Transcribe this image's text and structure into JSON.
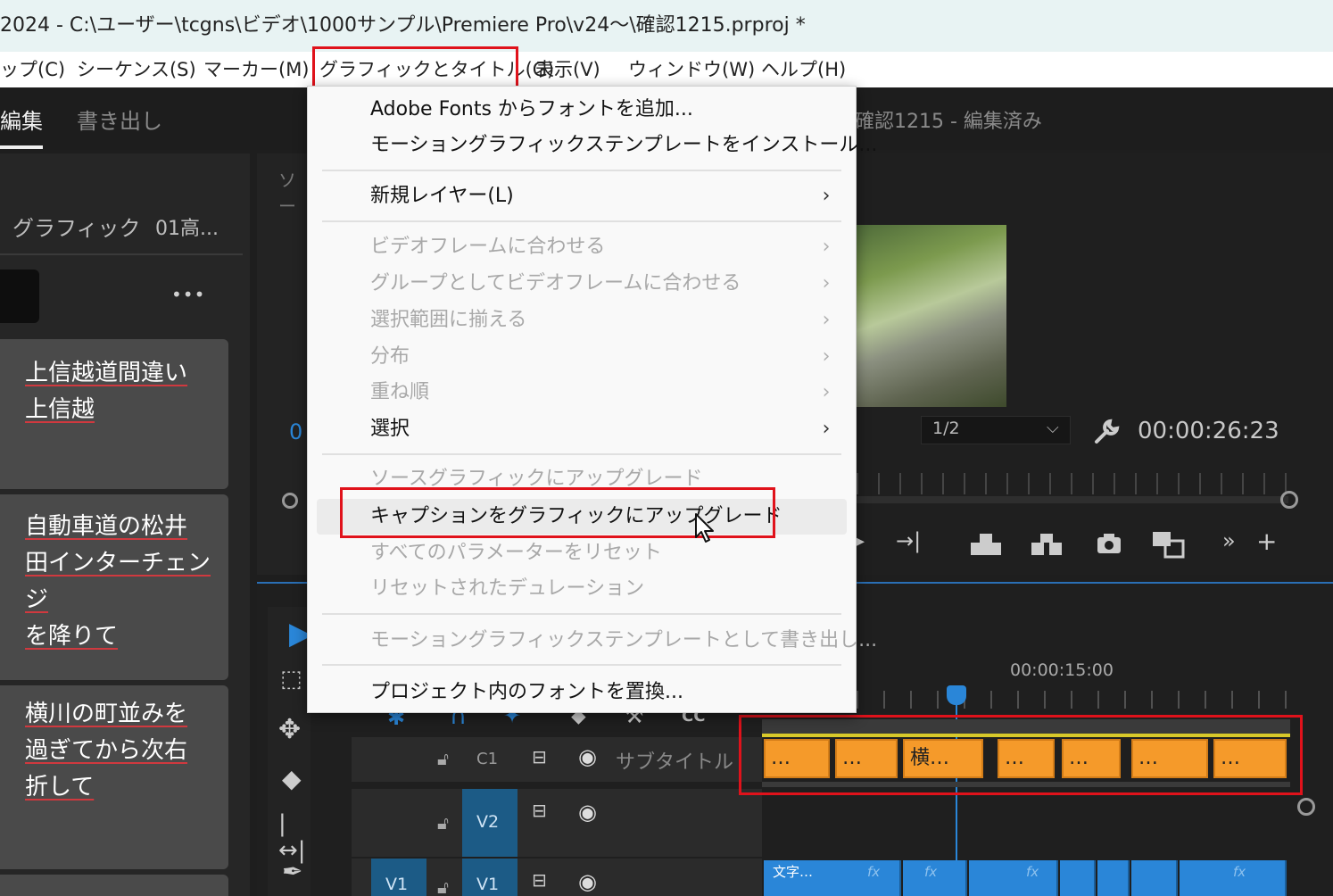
{
  "window": {
    "title": "2024 - C:\\ユーザー\\tcgns\\ビデオ\\1000サンプル\\Premiere Pro\\v24～\\確認1215.prproj *"
  },
  "menubar": {
    "items": [
      {
        "label": "ップ(C)"
      },
      {
        "label": "シーケンス(S)"
      },
      {
        "label": "マーカー(M)"
      },
      {
        "label": "グラフィックとタイトル(G)"
      },
      {
        "label": "表示(V)"
      },
      {
        "label": "ウィンドウ(W)"
      },
      {
        "label": "ヘルプ(H)"
      }
    ]
  },
  "workspace": {
    "tabs": [
      "編集",
      "書き出し"
    ],
    "sequence_title": "確認1215 - 編集済み"
  },
  "left_panel": {
    "tabs": [
      "グラフィック",
      "01高..."
    ],
    "more_label": "•••",
    "captions": [
      "上信越道間違い\n上信越",
      "自動車道の松井\n田インターチェンジ\nを降りて",
      "横川の町並みを\n過ぎてから次右\n折して"
    ]
  },
  "source_panel": {
    "label": "ソー",
    "timecode_fragment": "0"
  },
  "program_monitor": {
    "resolution": "1/2",
    "timecode": "00:00:26:23"
  },
  "timeline": {
    "ruler_time": "00:00:15:00",
    "tracks": [
      {
        "target": "C1",
        "name": "サブタイトル"
      },
      {
        "target": "V2",
        "name": ""
      },
      {
        "source": "V1",
        "target": "V1",
        "name": ""
      }
    ],
    "caption_clips": [
      "…",
      "…",
      "横…",
      "…",
      "…",
      "…",
      "…"
    ],
    "video_clip_label": "文字…",
    "fx_label": "fx"
  },
  "dropdown": {
    "items": [
      {
        "label": "Adobe Fonts からフォントを追加...",
        "enabled": true,
        "submenu": false
      },
      {
        "label": "モーショングラフィックステンプレートをインストール...",
        "enabled": true,
        "submenu": false
      },
      {
        "label": "新規レイヤー(L)",
        "enabled": true,
        "submenu": true
      },
      {
        "label": "ビデオフレームに合わせる",
        "enabled": false,
        "submenu": true
      },
      {
        "label": "グループとしてビデオフレームに合わせる",
        "enabled": false,
        "submenu": true
      },
      {
        "label": "選択範囲に揃える",
        "enabled": false,
        "submenu": true
      },
      {
        "label": "分布",
        "enabled": false,
        "submenu": true
      },
      {
        "label": "重ね順",
        "enabled": false,
        "submenu": true
      },
      {
        "label": "選択",
        "enabled": true,
        "submenu": true
      },
      {
        "label": "ソースグラフィックにアップグレード",
        "enabled": false,
        "submenu": false
      },
      {
        "label": "キャプションをグラフィックにアップグレード",
        "enabled": true,
        "submenu": false,
        "hovered": true
      },
      {
        "label": "すべてのパラメーターをリセット",
        "enabled": false,
        "submenu": false
      },
      {
        "label": "リセットされたデュレーション",
        "enabled": false,
        "submenu": false
      },
      {
        "label": "モーショングラフィックステンプレートとして書き出し...",
        "enabled": false,
        "submenu": false
      },
      {
        "label": "プロジェクト内のフォントを置換...",
        "enabled": true,
        "submenu": false
      }
    ]
  },
  "colors": {
    "highlight_box": "#e0121b",
    "caption_clip": "#f59a2a",
    "video_clip": "#2a86d8",
    "playhead": "#2a86d8"
  }
}
